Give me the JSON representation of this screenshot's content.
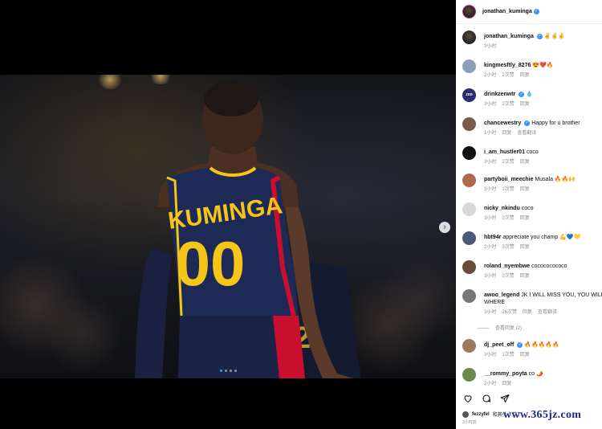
{
  "post": {
    "author": "jonathan_kuminga",
    "image": {
      "jersey_name": "KUMINGA",
      "jersey_number": "00",
      "carousel_dots": 4,
      "active_dot": 0
    }
  },
  "caption": {
    "user": "jonathan_kuminga",
    "text": "✌️✌️✌️",
    "time": "3小时"
  },
  "comments": [
    {
      "user": "kingmesftly_8276",
      "verified": false,
      "text": "😍❤️🔥",
      "time": "2小时",
      "likes": "2次赞",
      "reply": "回复",
      "extra": ""
    },
    {
      "user": "drinkzenwtr",
      "verified": true,
      "text": "💧",
      "time": "3小时",
      "likes": "2次赞",
      "reply": "回复",
      "extra": "",
      "avatar_label": "zen"
    },
    {
      "user": "chancewestry",
      "verified": true,
      "text": "Happy for u brother",
      "time": "1小时",
      "likes": "",
      "reply": "回复",
      "extra": "查看翻译"
    },
    {
      "user": "i_am_hustler01",
      "verified": false,
      "text": "coco",
      "time": "3小时",
      "likes": "2次赞",
      "reply": "回复",
      "extra": ""
    },
    {
      "user": "partyboii_meechie",
      "verified": false,
      "text": "Musala 🔥🔥🙌",
      "time": "3小时",
      "likes": "1次赞",
      "reply": "回复",
      "extra": ""
    },
    {
      "user": "nicky_nkindu",
      "verified": false,
      "text": "coco",
      "time": "3小时",
      "likes": "2次赞",
      "reply": "回复",
      "extra": ""
    },
    {
      "user": "hbt94r",
      "verified": false,
      "text": "appreciate you champ 💪💙💛",
      "time": "2小时",
      "likes": "3次赞",
      "reply": "回复",
      "extra": ""
    },
    {
      "user": "roland_nyembwe",
      "verified": false,
      "text": "cocococococo",
      "time": "3小时",
      "likes": "2次赞",
      "reply": "回复",
      "extra": ""
    },
    {
      "user": "awoo_legend",
      "verified": false,
      "text": "JK I WILL MISS YOU, YOU WILL WHERE",
      "time": "3小时",
      "likes": "26次赞",
      "reply": "回复",
      "extra": "查看翻译"
    },
    {
      "user": "dj_peet_off",
      "verified": true,
      "text": "🔥🔥🔥🔥🔥",
      "time": "3小时",
      "likes": "1次赞",
      "reply": "回复",
      "extra": ""
    },
    {
      "user": "__rommy_poyta",
      "verified": false,
      "text": "co 🌶️",
      "time": "2小时",
      "likes": "",
      "reply": "回复",
      "extra": ""
    }
  ],
  "view_replies": "查看回复 (2)",
  "footer": {
    "liker": "fezzyfel",
    "likes_text": "和其他人赞了",
    "time": "3小时前"
  },
  "watermark": "www.365jz.com",
  "colors": {
    "verified": "#3897f0",
    "jersey_navy": "#1d2a55",
    "jersey_gold": "#f5c518",
    "watermark": "#1d2a8f"
  }
}
